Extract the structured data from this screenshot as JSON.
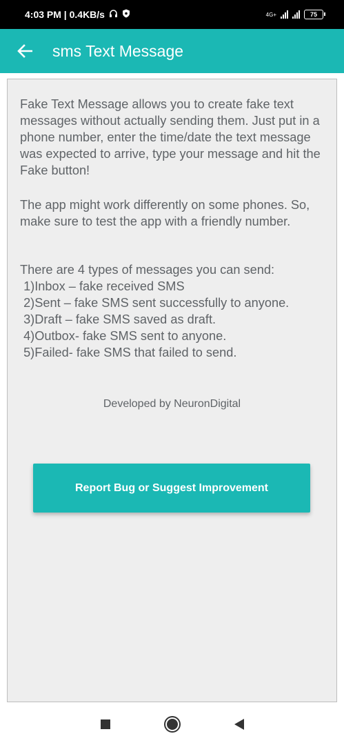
{
  "status_bar": {
    "time_speed": "4:03 PM | 0.4KB/s",
    "network_label": "4G+",
    "battery": "75"
  },
  "app_bar": {
    "title": "sms Text Message"
  },
  "content": {
    "paragraph1": "Fake Text Message allows you to create fake text messages without actually sending them. Just put in a phone number, enter the time/date the text message was expected to arrive, type your message and hit the Fake button!",
    "paragraph2": "The app might work differently on some phones. So, make sure to test the app with a friendly number.",
    "paragraph3": "There are 4 types of messages you can send:\n 1)Inbox – fake received SMS\n 2)Sent – fake SMS sent successfully to anyone.\n 3)Draft – fake SMS saved as draft.\n 4)Outbox- fake SMS sent to anyone.\n 5)Failed- fake SMS that failed to send.",
    "developer": "Developed by NeuronDigital",
    "report_button": "Report Bug or Suggest Improvement"
  },
  "colors": {
    "accent": "#1bb8b4",
    "body_text": "#5f6367",
    "panel_bg": "#eeeeee"
  },
  "icons": {
    "back": "arrow-left-icon",
    "headphones": "headphones-icon",
    "shield": "shield-icon",
    "signal": "signal-icon",
    "battery": "battery-icon",
    "nav_recents": "square-icon",
    "nav_home": "circle-icon",
    "nav_back": "triangle-back-icon"
  }
}
